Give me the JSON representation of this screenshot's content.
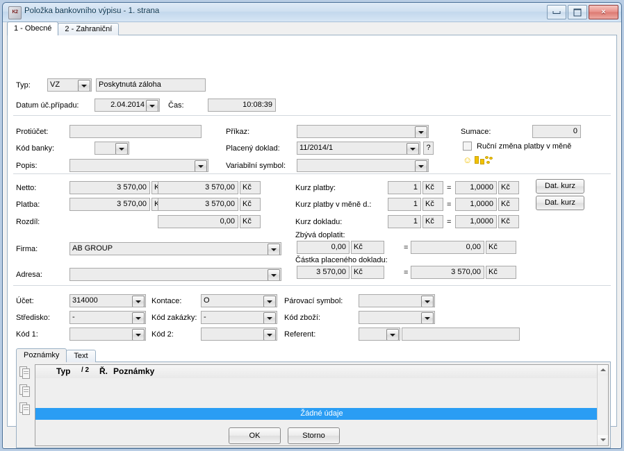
{
  "window": {
    "title": "Položka bankovního výpisu - 1. strana",
    "icon": "app-icon",
    "minimize": "minimize-icon",
    "maximize": "maximize-icon",
    "close": "×"
  },
  "tabs": [
    {
      "label": "1 - Obecné",
      "active": true
    },
    {
      "label": "2 - Zahraniční",
      "active": false
    }
  ],
  "header": {
    "typ_label": "Typ:",
    "typ_value": "VZ",
    "typ_desc": "Poskytnutá záloha",
    "datum_label": "Datum úč.případu:",
    "datum_value": "2.04.2014",
    "cas_label": "Čas:",
    "cas_value": "10:08:39"
  },
  "left": {
    "protiucet_label": "Protiúčet:",
    "protiucet_value": "",
    "kodbanky_label": "Kód banky:",
    "kodbanky_value": "",
    "popis_label": "Popis:",
    "popis_value": ""
  },
  "middle": {
    "prikaz_label": "Příkaz:",
    "prikaz_value": "",
    "placeny_label": "Placený doklad:",
    "placeny_value": "11/2014/1",
    "help_btn": "?",
    "varsymbol_label": "Variabilní symbol:",
    "varsymbol_value": ""
  },
  "right": {
    "sumace_label": "Sumace:",
    "sumace_value": "0",
    "rucni_label": "Ruční změna platby v měně",
    "rucni_checked": false,
    "smiley_icon": "☺",
    "coins_icon": "coins-icon"
  },
  "amounts": {
    "netto_label": "Netto:",
    "netto_v1": "3 570,00",
    "netto_u1": "Kč",
    "netto_v2": "3 570,00",
    "netto_u2": "Kč",
    "platba_label": "Platba:",
    "platba_v1": "3 570,00",
    "platba_u1": "Kč",
    "platba_v2": "3 570,00",
    "platba_u2": "Kč",
    "rozdil_label": "Rozdíl:",
    "rozdil_v2": "0,00",
    "rozdil_u2": "Kč"
  },
  "rates": {
    "kurz_platby_label": "Kurz platby:",
    "kurz_platby_v1": "1",
    "kurz_platby_u1": "Kč",
    "kurz_platby_eq": "=",
    "kurz_platby_v2": "1,0000",
    "kurz_platby_u2": "Kč",
    "kurz_platby_btn": "Dat. kurz",
    "kurz_meny_label": "Kurz platby v měně d.:",
    "kurz_meny_v1": "1",
    "kurz_meny_u1": "Kč",
    "kurz_meny_eq": "=",
    "kurz_meny_v2": "1,0000",
    "kurz_meny_u2": "Kč",
    "kurz_meny_btn": "Dat. kurz",
    "kurz_dokladu_label": "Kurz dokladu:",
    "kurz_dokladu_v1": "1",
    "kurz_dokladu_u1": "Kč",
    "kurz_dokladu_eq": "=",
    "kurz_dokladu_v2": "1,0000",
    "kurz_dokladu_u2": "Kč"
  },
  "remaining": {
    "zbyva_label": "Zbývá doplatit:",
    "zbyva_v1": "0,00",
    "zbyva_u1": "Kč",
    "zbyva_eq": "=",
    "zbyva_v2": "0,00",
    "zbyva_u2": "Kč",
    "castka_label": "Částka placeného dokladu:",
    "castka_v1": "3 570,00",
    "castka_u1": "Kč",
    "castka_eq": "=",
    "castka_v2": "3 570,00",
    "castka_u2": "Kč"
  },
  "company": {
    "firma_label": "Firma:",
    "firma_value": "AB GROUP",
    "adresa_label": "Adresa:",
    "adresa_value": ""
  },
  "accounting": {
    "ucet_label": "Účet:",
    "ucet_value": "314000",
    "kontace_label": "Kontace:",
    "kontace_value": "O",
    "parovaci_label": "Párovací symbol:",
    "parovaci_value": "",
    "stredisko_label": "Středisko:",
    "stredisko_value": "-",
    "zakazky_label": "Kód zakázky:",
    "zakazky_value": "-",
    "zbozi_label": "Kód zboží:",
    "zbozi_value": "",
    "kod1_label": "Kód 1:",
    "kod1_value": "",
    "kod2_label": "Kód 2:",
    "kod2_value": "",
    "referent_label": "Referent:",
    "referent_value": "",
    "referent_name": ""
  },
  "notes": {
    "tabs": [
      {
        "label": "Poznámky",
        "active": true
      },
      {
        "label": "Text",
        "active": false
      }
    ],
    "columns": [
      "Typ",
      "/ 2",
      "Ř.",
      "Poznámky"
    ],
    "empty_text": "Žádné údaje"
  },
  "footer": {
    "ok": "OK",
    "cancel": "Storno"
  }
}
